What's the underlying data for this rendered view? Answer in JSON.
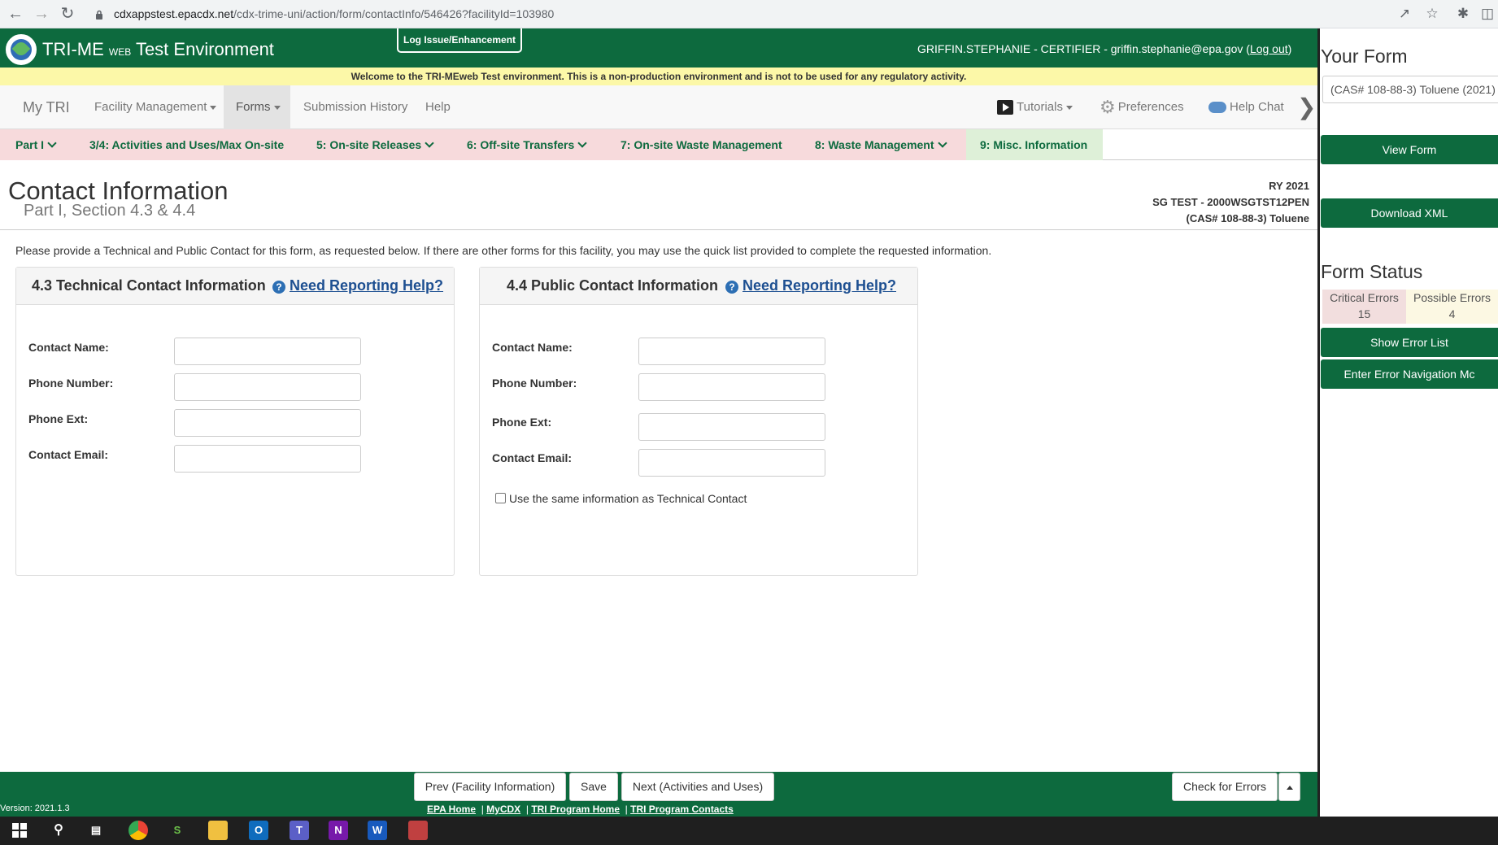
{
  "browser": {
    "url_host": "cdxappstest.epacdx.net",
    "url_path": "/cdx-trime-uni/action/form/contactInfo/546426?facilityId=103980"
  },
  "header": {
    "app_title_pre": "TRI-ME ",
    "app_title_web": "WEB",
    "app_title_post": " Test Environment",
    "log_issue": "Log Issue/Enhancement",
    "user": "GRIFFIN.STEPHANIE - CERTIFIER - griffin.stephanie@epa.gov (",
    "logout": "Log out",
    "user_close": ")"
  },
  "banner": "Welcome to the TRI-MEweb Test environment. This is a non-production environment and is not to be used for any regulatory activity.",
  "nav": {
    "my_tri": "My TRI",
    "facility_management": "Facility Management",
    "forms": "Forms",
    "submission_history": "Submission History",
    "help": "Help",
    "tutorials": "Tutorials",
    "preferences": "Preferences",
    "help_chat": "Help Chat"
  },
  "tabs": [
    "Part I",
    "3/4: Activities and Uses/Max On-site",
    "5: On-site Releases",
    "6: Off-site Transfers",
    "7: On-site Waste Management",
    "8: Waste Management",
    "9: Misc. Information"
  ],
  "page": {
    "title": "Contact Information",
    "subtitle": "Part I, Section 4.3 & 4.4",
    "ry": "RY 2021",
    "facility": "SG TEST - 2000WSGTST12PEN",
    "chemical": "(CAS# 108-88-3) Toluene",
    "intro": "Please provide a Technical and Public Contact for this form, as requested below. If there are other forms for this facility, you may use the quick list provided to complete the requested information."
  },
  "technical": {
    "title": "4.3 Technical Contact Information",
    "help": "Need Reporting Help?",
    "contact_name": "Contact Name:",
    "phone_number": "Phone Number:",
    "phone_ext": "Phone Ext:",
    "contact_email": "Contact Email:"
  },
  "public": {
    "title": "4.4 Public Contact Information",
    "help": "Need Reporting Help?",
    "contact_name": "Contact Name:",
    "phone_number": "Phone Number:",
    "phone_ext": "Phone Ext:",
    "contact_email": "Contact Email:",
    "same_as": "Use the same information as Technical Contact"
  },
  "footer": {
    "prev": "Prev (Facility Information)",
    "save": "Save",
    "next": "Next (Activities and Uses)",
    "check": "Check for Errors",
    "version": "Version: 2021.1.3",
    "links": [
      "EPA Home",
      "MyCDX",
      "TRI Program Home",
      "TRI Program Contacts"
    ]
  },
  "sidebar": {
    "your_form": "Your Form",
    "form_select": "(CAS# 108-88-3) Toluene (2021)",
    "view_form": "View Form",
    "download_xml": "Download XML",
    "form_status": "Form Status",
    "critical_label": "Critical Errors",
    "critical_count": "15",
    "possible_label": "Possible Errors",
    "possible_count": "4",
    "show_errors": "Show Error List",
    "enter_nav": "Enter Error Navigation Mc"
  },
  "colors": {
    "brand_green": "#0d6a3e",
    "banner_yellow": "#fcf8a8",
    "tab_pink": "#f7dadc",
    "tab_green": "#def0d8",
    "link_blue": "#1d4f91"
  }
}
